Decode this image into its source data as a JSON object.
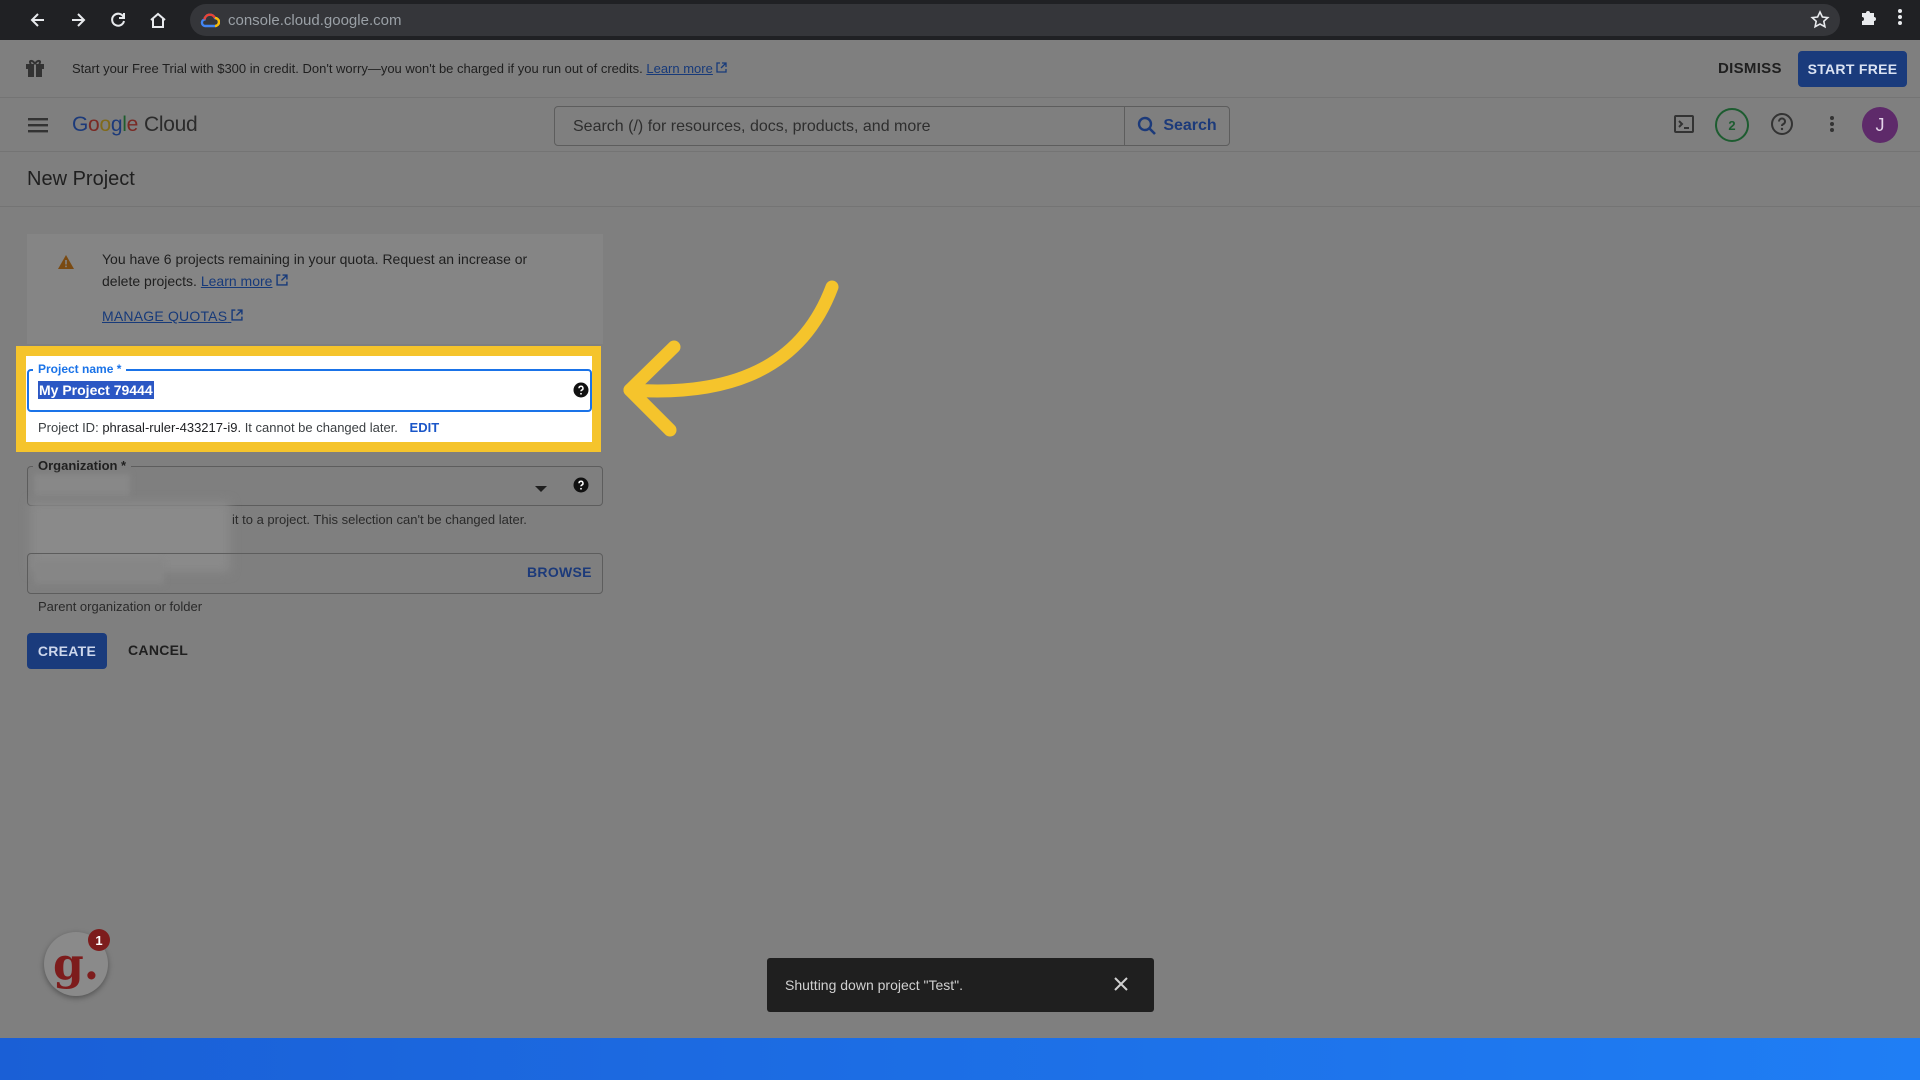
{
  "browser": {
    "url": "console.cloud.google.com"
  },
  "trial_banner": {
    "message": "Start your Free Trial with $300 in credit. Don't worry—you won't be charged if you run out of credits.",
    "learn_more": "Learn more",
    "dismiss_label": "DISMISS",
    "start_free_label": "START FREE"
  },
  "header": {
    "logo_google": [
      "G",
      "o",
      "o",
      "g",
      "l",
      "e"
    ],
    "logo_cloud": "Cloud",
    "search_placeholder": "Search (/) for resources, docs, products, and more",
    "search_button": "Search",
    "notification_count": "2",
    "avatar_initial": "J"
  },
  "page": {
    "title": "New Project"
  },
  "quota_notice": {
    "text": "You have 6 projects remaining in your quota. Request an increase or delete projects.",
    "learn_more": "Learn more",
    "manage_quotas": "MANAGE QUOTAS"
  },
  "form": {
    "project_name_label": "Project name *",
    "project_name_value": "My Project 79444",
    "project_id_prefix": "Project ID:",
    "project_id_value": "phrasal-ruler-433217-i9.",
    "project_id_suffix": "It cannot be changed later.",
    "edit_label": "EDIT",
    "organization_label": "Organization *",
    "organization_hint": "it to a project. This selection can't be changed later.",
    "browse_label": "BROWSE",
    "location_hint": "Parent organization or folder",
    "create_label": "CREATE",
    "cancel_label": "CANCEL"
  },
  "snackbar": {
    "message": "Shutting down project \"Test\"."
  },
  "widget": {
    "letter": "g.",
    "badge_count": "1"
  },
  "colors": {
    "highlight": "#f5c42c",
    "primary_button": "#1a3b7c",
    "focus_blue": "#1a73e8"
  }
}
